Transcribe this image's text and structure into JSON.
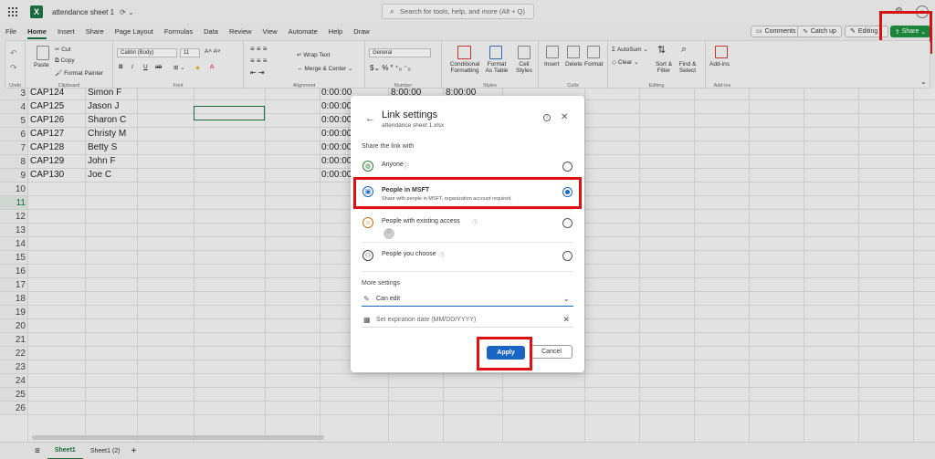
{
  "titlebar": {
    "doc_title": "attendance sheet 1",
    "search_placeholder": "Search for tools, help, and more (Alt + Q)"
  },
  "menu": {
    "tabs": [
      "File",
      "Home",
      "Insert",
      "Share",
      "Page Layout",
      "Formulas",
      "Data",
      "Review",
      "View",
      "Automate",
      "Help",
      "Draw"
    ],
    "active": "Home",
    "comments": "Comments",
    "catchup": "Catch up",
    "editing": "Editing",
    "share": "Share"
  },
  "ribbon": {
    "undo_label": "Undo",
    "clipboard": {
      "paste": "Paste",
      "cut": "Cut",
      "copy": "Copy",
      "format_painter": "Format Painter",
      "label": "Clipboard"
    },
    "font": {
      "name": "Calibri (Body)",
      "size": "11",
      "label": "Font"
    },
    "alignment": {
      "wrap": "Wrap Text",
      "merge": "Merge & Center",
      "label": "Alignment"
    },
    "number": {
      "format": "General",
      "label": "Number"
    },
    "styles": {
      "cond": "Conditional Formatting",
      "table": "Format As Table",
      "cell": "Cell Styles",
      "label": "Styles"
    },
    "cells": {
      "insert": "Insert",
      "delete": "Delete",
      "format": "Format",
      "label": "Cells"
    },
    "editing": {
      "autosum": "AutoSum",
      "clear": "Clear",
      "sort": "Sort & Filter",
      "find": "Find & Select",
      "label": "Editing"
    },
    "addins": {
      "name": "Add-ins",
      "label": "Add-ins"
    }
  },
  "grid": {
    "rows": [
      {
        "n": "3",
        "a": "CAP124",
        "b": "Simon F",
        "e": "0:00:00",
        "f": "8:00:00",
        "g": "8:00:00"
      },
      {
        "n": "4",
        "a": "CAP125",
        "b": "Jason J",
        "e": "0:00:00",
        "f": "",
        "g": ""
      },
      {
        "n": "5",
        "a": "CAP126",
        "b": "Sharon C",
        "e": "0:00:00",
        "f": "",
        "g": ""
      },
      {
        "n": "6",
        "a": "CAP127",
        "b": "Christy M",
        "e": "0:00:00",
        "f": "",
        "g": ""
      },
      {
        "n": "7",
        "a": "CAP128",
        "b": "Betty S",
        "e": "0:00:00",
        "f": "",
        "g": ""
      },
      {
        "n": "8",
        "a": "CAP129",
        "b": "John F",
        "e": "0:00:00",
        "f": "",
        "g": ""
      },
      {
        "n": "9",
        "a": "CAP130",
        "b": "Joe C",
        "e": "0:00:00",
        "f": "",
        "g": ""
      },
      {
        "n": "10",
        "a": "",
        "b": "",
        "e": "",
        "f": "",
        "g": ""
      },
      {
        "n": "11",
        "a": "",
        "b": "",
        "e": "",
        "f": "",
        "g": ""
      },
      {
        "n": "12",
        "a": "",
        "b": "",
        "e": "",
        "f": "",
        "g": ""
      },
      {
        "n": "13",
        "a": "",
        "b": "",
        "e": "",
        "f": "",
        "g": ""
      },
      {
        "n": "14",
        "a": "",
        "b": "",
        "e": "",
        "f": "",
        "g": ""
      },
      {
        "n": "15",
        "a": "",
        "b": "",
        "e": "",
        "f": "",
        "g": ""
      },
      {
        "n": "16",
        "a": "",
        "b": "",
        "e": "",
        "f": "",
        "g": ""
      },
      {
        "n": "17",
        "a": "",
        "b": "",
        "e": "",
        "f": "",
        "g": ""
      },
      {
        "n": "18",
        "a": "",
        "b": "",
        "e": "",
        "f": "",
        "g": ""
      },
      {
        "n": "19",
        "a": "",
        "b": "",
        "e": "",
        "f": "",
        "g": ""
      },
      {
        "n": "20",
        "a": "",
        "b": "",
        "e": "",
        "f": "",
        "g": ""
      },
      {
        "n": "21",
        "a": "",
        "b": "",
        "e": "",
        "f": "",
        "g": ""
      },
      {
        "n": "22",
        "a": "",
        "b": "",
        "e": "",
        "f": "",
        "g": ""
      },
      {
        "n": "23",
        "a": "",
        "b": "",
        "e": "",
        "f": "",
        "g": ""
      },
      {
        "n": "24",
        "a": "",
        "b": "",
        "e": "",
        "f": "",
        "g": ""
      },
      {
        "n": "25",
        "a": "",
        "b": "",
        "e": "",
        "f": "",
        "g": ""
      },
      {
        "n": "26",
        "a": "",
        "b": "",
        "e": "",
        "f": "",
        "g": ""
      }
    ],
    "selected_row": "11"
  },
  "sheets": {
    "tabs": [
      "Sheet1",
      "Sheet1 (2)"
    ],
    "active": "Sheet1"
  },
  "dialog": {
    "title": "Link settings",
    "subtitle": "attendance sheet 1.xlsx",
    "share_with_label": "Share the link with",
    "options": [
      {
        "label": "Anyone",
        "desc": "",
        "icon": "globe-icon",
        "selected": false
      },
      {
        "label": "People in MSFT",
        "desc": "Share with people in MSFT, organization account required.",
        "icon": "building-icon",
        "selected": true
      },
      {
        "label": "People with existing access",
        "desc": "",
        "icon": "person-icon",
        "selected": false
      },
      {
        "label": "People you choose",
        "desc": "",
        "icon": "people-icon",
        "selected": false
      }
    ],
    "more_settings_label": "More settings",
    "permission": "Can edit",
    "expiration_placeholder": "Set expiration date (MM/DD/YYYY)",
    "apply": "Apply",
    "cancel": "Cancel"
  },
  "colors": {
    "excel_green": "#1d6f42",
    "share_green": "#1f8a3f",
    "accent_blue": "#1a64c4",
    "highlight_red": "#e01010"
  }
}
